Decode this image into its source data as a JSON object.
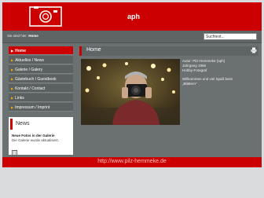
{
  "header": {
    "title": "aph",
    "logo_icon": "camera-icon",
    "brand_color": "#cc0000"
  },
  "topbar": {
    "breadcrumb_prefix": "Sie sind hier:",
    "breadcrumb_current": "Home",
    "search_value": "Suchtext..."
  },
  "sidebar": {
    "items": [
      {
        "label": "Home",
        "active": true
      },
      {
        "label": "Aktuelles / News",
        "active": false
      },
      {
        "label": "Galerie / Galery",
        "active": false
      },
      {
        "label": "Gästebuch / Guestbook",
        "active": false
      },
      {
        "label": "Kontakt / Contact",
        "active": false
      },
      {
        "label": "Links",
        "active": false
      },
      {
        "label": "Impressum / Imprint",
        "active": false
      }
    ]
  },
  "news": {
    "heading": "News",
    "item_title": "Neue Fotos in der Galerie",
    "item_text": "Die Galerie wurde aktualisiert.",
    "more_glyph": "[]"
  },
  "content": {
    "title": "Home",
    "print_icon": "print-icon",
    "photo_icon": "self-portrait-photo",
    "intro_lines": [
      "Autor: Pilz-Hemmeke (aph)",
      "Jahrgang 1956",
      "Hobby-Fotograf"
    ],
    "welcome_lines": [
      "Willkommen und viel Spaß beim",
      "„Blättern“"
    ]
  },
  "footer": {
    "url": "http://www.pilz-hemmeke.de"
  }
}
